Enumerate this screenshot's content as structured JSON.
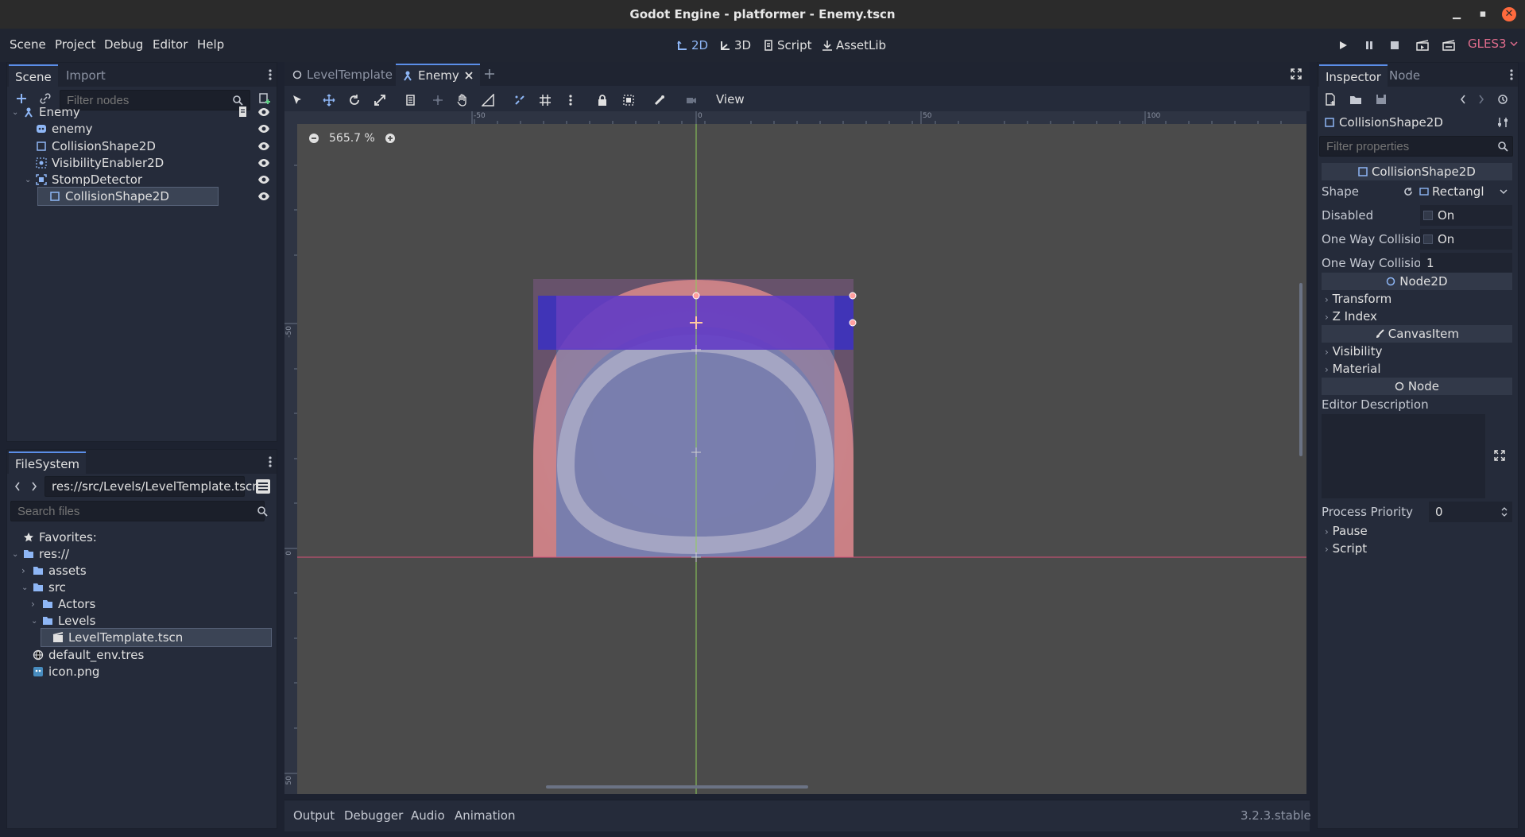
{
  "window": {
    "title": "Godot Engine - platformer - Enemy.tscn"
  },
  "menubar": {
    "menus": [
      "Scene",
      "Project",
      "Debug",
      "Editor",
      "Help"
    ],
    "workspaces": [
      "2D",
      "3D",
      "Script",
      "AssetLib"
    ],
    "active_workspace": "2D",
    "renderer": "GLES3"
  },
  "scene_dock": {
    "tabs": [
      "Scene",
      "Import"
    ],
    "filter_placeholder": "Filter nodes",
    "nodes": [
      {
        "label": "Enemy",
        "icon": "kinematic-body-icon",
        "depth": 0
      },
      {
        "label": "enemy",
        "icon": "sprite-icon",
        "depth": 1
      },
      {
        "label": "CollisionShape2D",
        "icon": "collision-shape-icon",
        "depth": 1
      },
      {
        "label": "VisibilityEnabler2D",
        "icon": "visibility-enabler-icon",
        "depth": 1
      },
      {
        "label": "StompDetector",
        "icon": "area2d-icon",
        "depth": 1
      },
      {
        "label": "CollisionShape2D",
        "icon": "collision-shape-icon",
        "depth": 2
      }
    ],
    "selected_node": "CollisionShape2D"
  },
  "filesystem": {
    "title": "FileSystem",
    "path": "res://src/Levels/LevelTemplate.tscn",
    "search_placeholder": "Search files",
    "items": [
      {
        "label": "Favorites:",
        "icon": "star-icon",
        "depth": 0
      },
      {
        "label": "res://",
        "icon": "folder-icon",
        "depth": 0
      },
      {
        "label": "assets",
        "icon": "folder-icon",
        "depth": 1
      },
      {
        "label": "src",
        "icon": "folder-icon",
        "depth": 1
      },
      {
        "label": "Actors",
        "icon": "folder-icon",
        "depth": 2
      },
      {
        "label": "Levels",
        "icon": "folder-icon",
        "depth": 2
      },
      {
        "label": "LevelTemplate.tscn",
        "icon": "scene-file-icon",
        "depth": 3
      },
      {
        "label": "default_env.tres",
        "icon": "environment-icon",
        "depth": 1
      },
      {
        "label": "icon.png",
        "icon": "image-icon",
        "depth": 1
      }
    ],
    "selected_item": "LevelTemplate.tscn"
  },
  "editor": {
    "scene_tabs": [
      "LevelTemplate",
      "Enemy"
    ],
    "active_tab": "Enemy",
    "view_menu": "View",
    "zoom": "565.7 %",
    "ruler_labels": {
      "top": [
        "-50",
        "0",
        "50",
        "100"
      ],
      "left": [
        "-50",
        "0",
        "50"
      ]
    }
  },
  "bottom_panel": {
    "tabs": [
      "Output",
      "Debugger",
      "Audio",
      "Animation"
    ],
    "version": "3.2.3.stable"
  },
  "inspector": {
    "tabs": [
      "Inspector",
      "Node"
    ],
    "object": "CollisionShape2D",
    "filter_placeholder": "Filter properties",
    "class_header": "CollisionShape2D",
    "properties": [
      {
        "name": "Shape",
        "value": "Rectangl"
      },
      {
        "name": "Disabled",
        "value": "On"
      },
      {
        "name": "One Way Collisio",
        "value": "On"
      },
      {
        "name": "One Way Collisio",
        "value": "1"
      }
    ],
    "node2d_header": "Node2D",
    "node2d_sections": [
      "Transform",
      "Z Index"
    ],
    "canvasitem_header": "CanvasItem",
    "canvasitem_sections": [
      "Visibility",
      "Material"
    ],
    "node_header": "Node",
    "editor_description_label": "Editor Description",
    "process_priority": {
      "name": "Process Priority",
      "value": "0"
    },
    "node_sections": [
      "Pause",
      "Script"
    ]
  },
  "colors": {
    "accent": "#5b8ee8",
    "renderer": "#e06c8c",
    "close": "#ff6a3d",
    "selection_rect": "#3a2fc4",
    "enemy_body": "#ffa98a"
  }
}
